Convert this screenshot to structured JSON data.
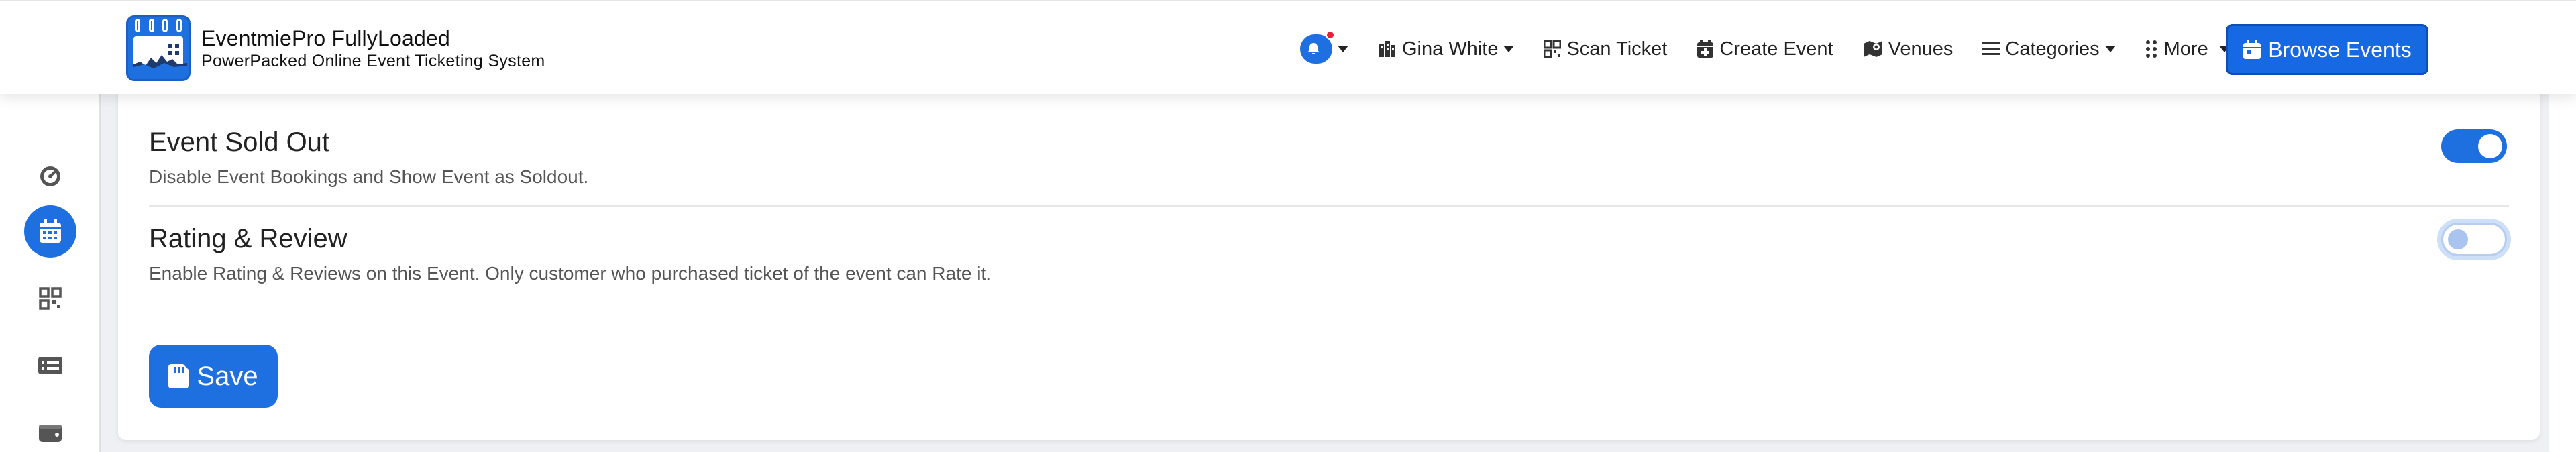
{
  "brand": {
    "title": "EventmiePro FullyLoaded",
    "subtitle": "PowerPacked Online Event Ticketing System"
  },
  "nav": {
    "user_name": "Gina White",
    "scan_ticket": "Scan Ticket",
    "create_event": "Create Event",
    "venues": "Venues",
    "categories": "Categories",
    "more": "More",
    "browse_events": "Browse Events"
  },
  "settings": [
    {
      "title": "Event Sold Out",
      "description": "Disable Event Bookings and Show Event as Soldout.",
      "enabled": true
    },
    {
      "title": "Rating & Review",
      "description": "Enable Rating & Reviews on this Event. Only customer who purchased ticket of the event can Rate it.",
      "enabled": false
    }
  ],
  "save_label": "Save",
  "sidebar_icons": [
    "dashboard-icon",
    "calendar-icon",
    "qr-code-icon",
    "ticket-icon",
    "wallet-icon"
  ],
  "colors": {
    "primary": "#1e6fe0",
    "notification_dot": "#e0243a"
  }
}
